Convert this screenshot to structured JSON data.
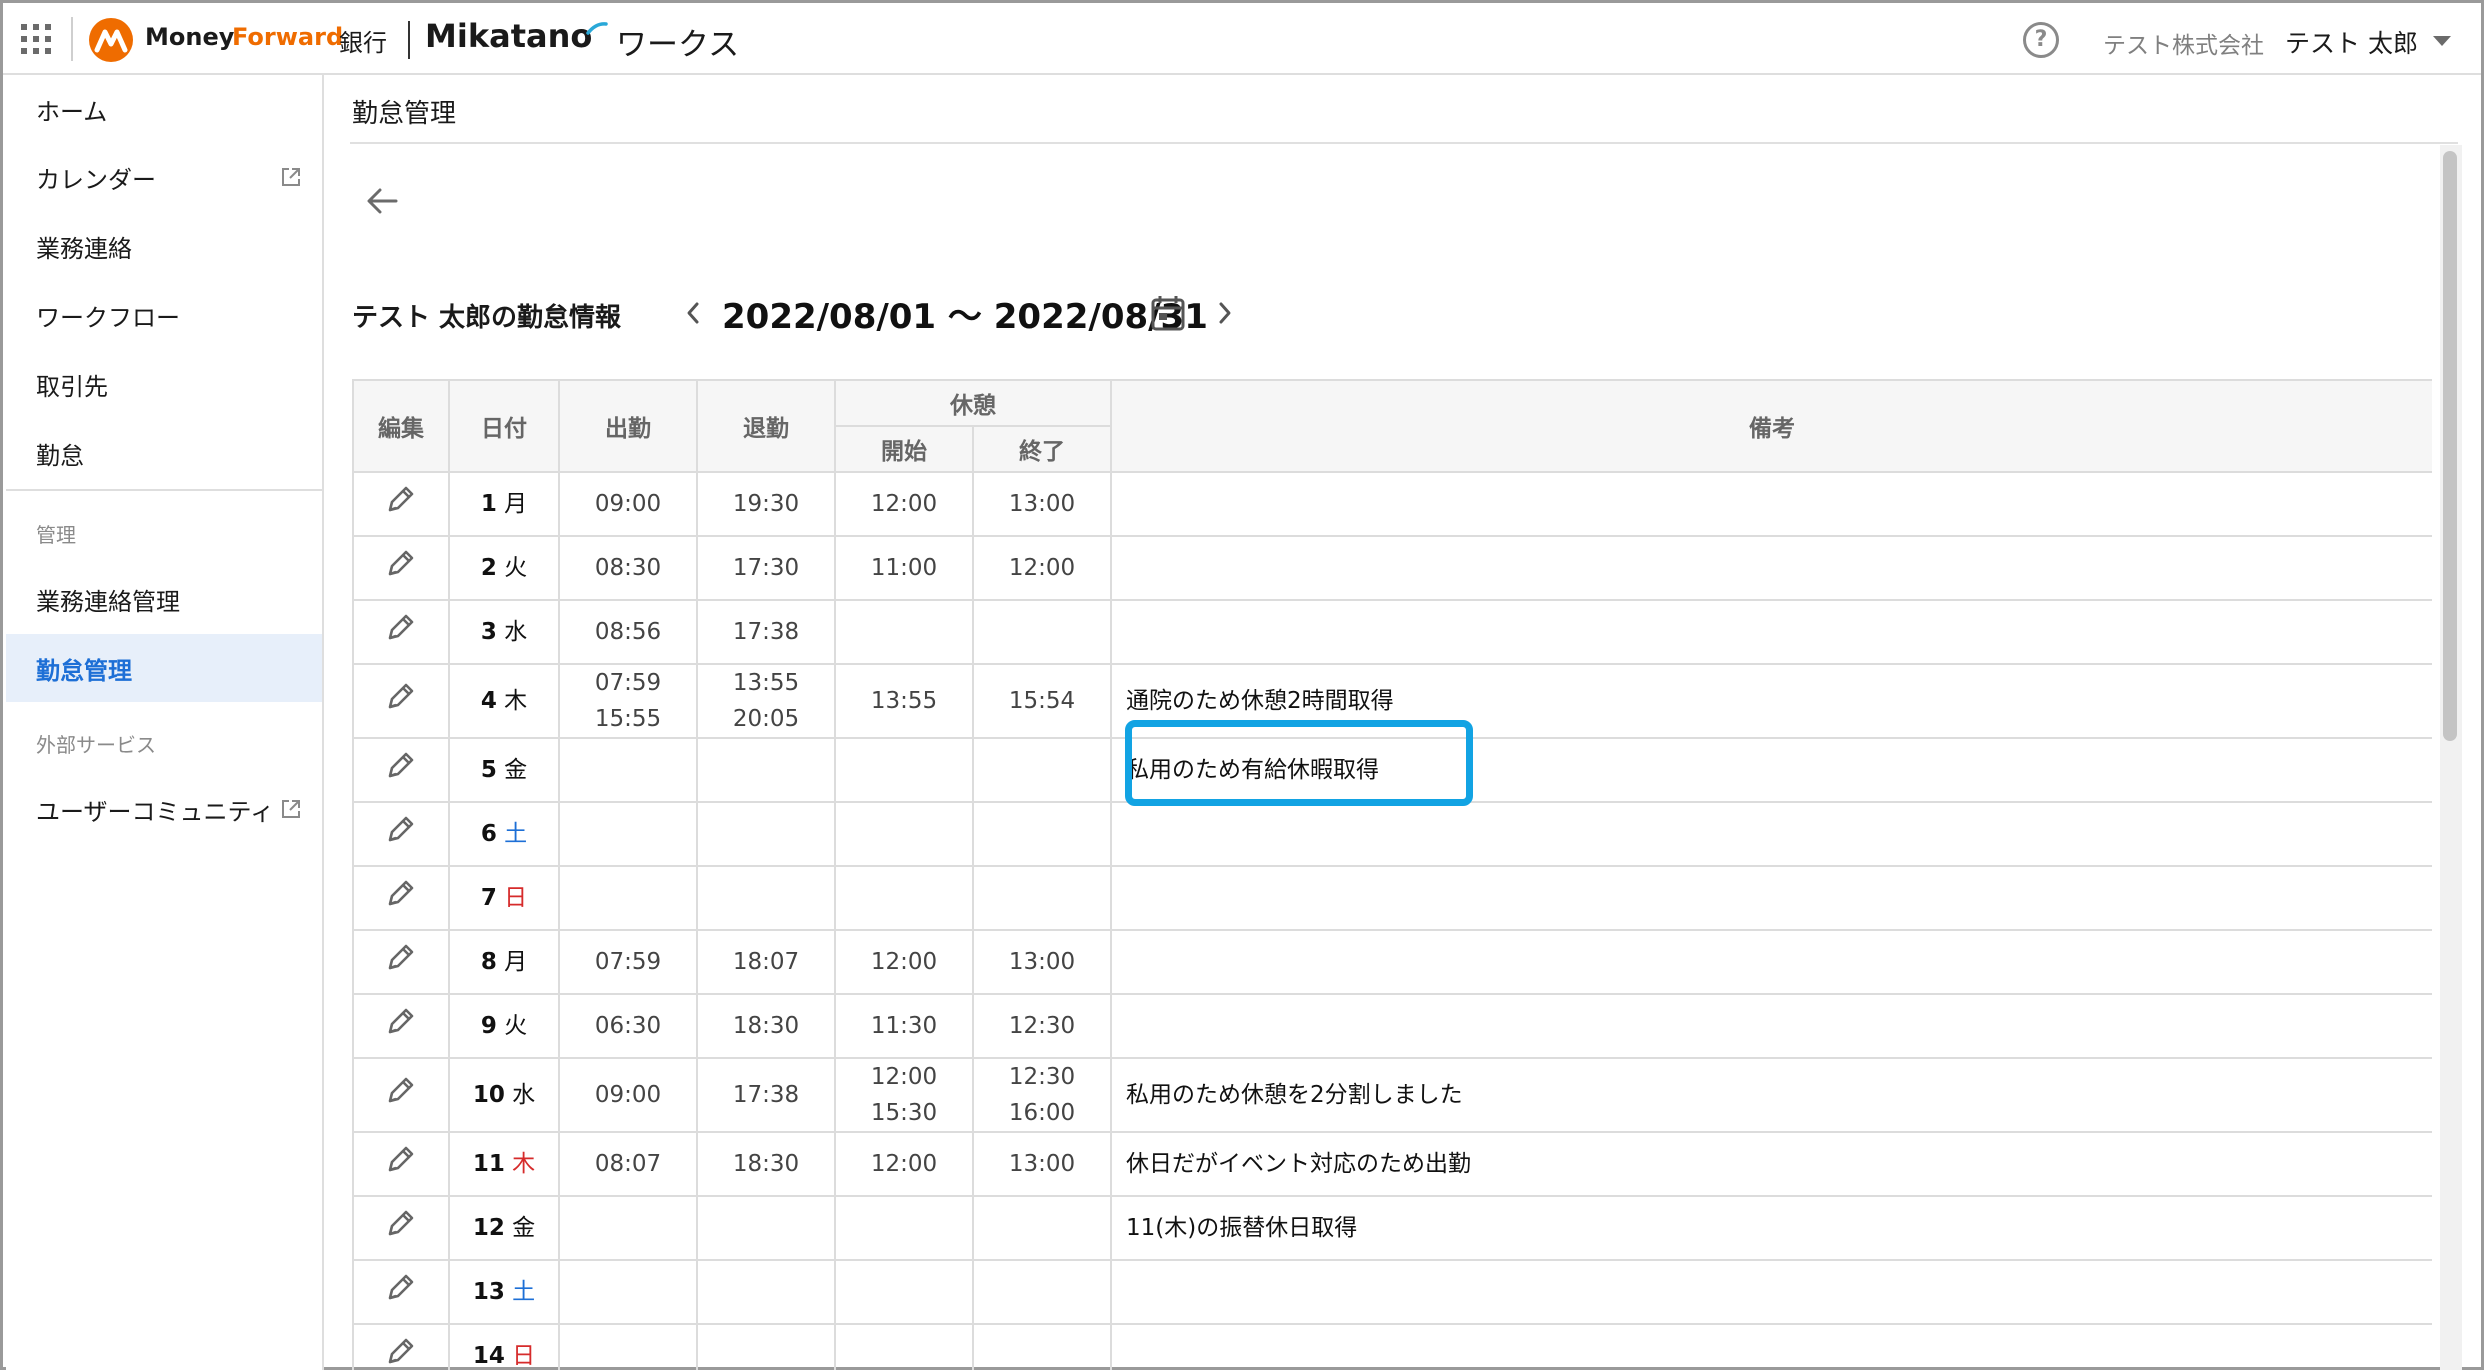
{
  "header": {
    "brand_money": "Money",
    "brand_forward": "Forward",
    "brand_bank": "銀行",
    "brand_mikatano": "Mikatano",
    "brand_works": "ワークス",
    "company": "テスト株式会社",
    "user": "テスト 太郎"
  },
  "sidebar": {
    "items": [
      {
        "label": "ホーム"
      },
      {
        "label": "カレンダー"
      },
      {
        "label": "業務連絡"
      },
      {
        "label": "ワークフロー"
      },
      {
        "label": "取引先"
      },
      {
        "label": "勤怠"
      }
    ],
    "section_admin": "管理",
    "admin_items": [
      {
        "label": "業務連絡管理"
      },
      {
        "label": "勤怠管理"
      }
    ],
    "section_external": "外部サービス",
    "external_items": [
      {
        "label": "ユーザーコミュニティ"
      }
    ]
  },
  "main": {
    "page_title": "勤怠管理",
    "info_title": "テスト 太郎の勤怠情報",
    "period": "2022/08/01 〜 2022/08/31"
  },
  "table": {
    "headers": {
      "edit": "編集",
      "date": "日付",
      "clock_in": "出勤",
      "clock_out": "退勤",
      "break": "休憩",
      "break_start": "開始",
      "break_end": "終了",
      "remarks": "備考"
    },
    "rows": [
      {
        "day": "1",
        "dow": "月",
        "dow_type": "weekday",
        "in": "09:00",
        "out": "19:30",
        "bstart": "12:00",
        "bend": "13:00",
        "note": ""
      },
      {
        "day": "2",
        "dow": "火",
        "dow_type": "weekday",
        "in": "08:30",
        "out": "17:30",
        "bstart": "11:00",
        "bend": "12:00",
        "note": ""
      },
      {
        "day": "3",
        "dow": "水",
        "dow_type": "weekday",
        "in": "08:56",
        "out": "17:38",
        "bstart": "",
        "bend": "",
        "note": ""
      },
      {
        "day": "4",
        "dow": "木",
        "dow_type": "weekday",
        "in": "07:59",
        "in2": "15:55",
        "out": "13:55",
        "out2": "20:05",
        "bstart": "13:55",
        "bend": "15:54",
        "note": "通院のため休憩2時間取得"
      },
      {
        "day": "5",
        "dow": "金",
        "dow_type": "weekday",
        "in": "",
        "out": "",
        "bstart": "",
        "bend": "",
        "note": "私用のため有給休暇取得"
      },
      {
        "day": "6",
        "dow": "土",
        "dow_type": "sat",
        "in": "",
        "out": "",
        "bstart": "",
        "bend": "",
        "note": ""
      },
      {
        "day": "7",
        "dow": "日",
        "dow_type": "sun",
        "in": "",
        "out": "",
        "bstart": "",
        "bend": "",
        "note": ""
      },
      {
        "day": "8",
        "dow": "月",
        "dow_type": "weekday",
        "in": "07:59",
        "out": "18:07",
        "bstart": "12:00",
        "bend": "13:00",
        "note": ""
      },
      {
        "day": "9",
        "dow": "火",
        "dow_type": "weekday",
        "in": "06:30",
        "out": "18:30",
        "bstart": "11:30",
        "bend": "12:30",
        "note": ""
      },
      {
        "day": "10",
        "dow": "水",
        "dow_type": "weekday",
        "in": "09:00",
        "out": "17:38",
        "bstart": "12:00",
        "bstart2": "15:30",
        "bend": "12:30",
        "bend2": "16:00",
        "note": "私用のため休憩を2分割しました"
      },
      {
        "day": "11",
        "dow": "木",
        "dow_type": "holiday",
        "in": "08:07",
        "out": "18:30",
        "bstart": "12:00",
        "bend": "13:00",
        "note": "休日だがイベント対応のため出勤"
      },
      {
        "day": "12",
        "dow": "金",
        "dow_type": "weekday",
        "in": "",
        "out": "",
        "bstart": "",
        "bend": "",
        "note": "11(木)の振替休日取得"
      },
      {
        "day": "13",
        "dow": "土",
        "dow_type": "sat",
        "in": "",
        "out": "",
        "bstart": "",
        "bend": "",
        "note": ""
      },
      {
        "day": "14",
        "dow": "日",
        "dow_type": "sun",
        "in": "",
        "out": "",
        "bstart": "",
        "bend": "",
        "note": ""
      }
    ]
  },
  "colors": {
    "accent_blue": "#1d6fd6",
    "highlight": "#12a3e3",
    "sunday_red": "#d62b2b",
    "brand_orange": "#ef6c00"
  }
}
